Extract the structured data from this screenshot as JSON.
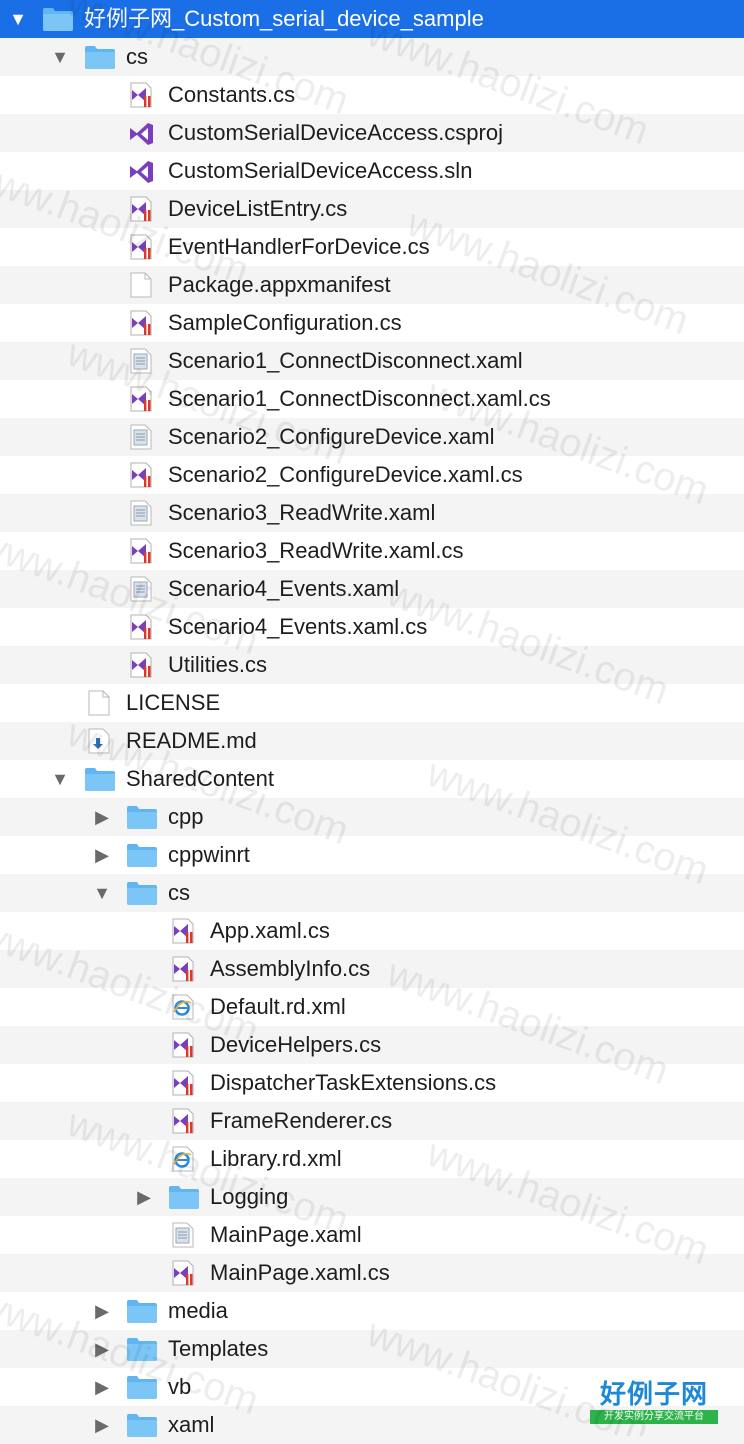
{
  "tree": [
    {
      "label": "好例子网_Custom_serial_device_sample",
      "type": "folder",
      "level": 0,
      "arrow": "expanded",
      "selected": true
    },
    {
      "label": "cs",
      "type": "folder",
      "level": 1,
      "arrow": "expanded"
    },
    {
      "label": "Constants.cs",
      "type": "cs",
      "level": 2
    },
    {
      "label": "CustomSerialDeviceAccess.csproj",
      "type": "vs",
      "level": 2
    },
    {
      "label": "CustomSerialDeviceAccess.sln",
      "type": "vs",
      "level": 2
    },
    {
      "label": "DeviceListEntry.cs",
      "type": "cs",
      "level": 2
    },
    {
      "label": "EventHandlerForDevice.cs",
      "type": "cs",
      "level": 2
    },
    {
      "label": "Package.appxmanifest",
      "type": "blank",
      "level": 2
    },
    {
      "label": "SampleConfiguration.cs",
      "type": "cs",
      "level": 2
    },
    {
      "label": "Scenario1_ConnectDisconnect.xaml",
      "type": "xaml",
      "level": 2
    },
    {
      "label": "Scenario1_ConnectDisconnect.xaml.cs",
      "type": "cs",
      "level": 2
    },
    {
      "label": "Scenario2_ConfigureDevice.xaml",
      "type": "xaml",
      "level": 2
    },
    {
      "label": "Scenario2_ConfigureDevice.xaml.cs",
      "type": "cs",
      "level": 2
    },
    {
      "label": "Scenario3_ReadWrite.xaml",
      "type": "xaml",
      "level": 2
    },
    {
      "label": "Scenario3_ReadWrite.xaml.cs",
      "type": "cs",
      "level": 2
    },
    {
      "label": "Scenario4_Events.xaml",
      "type": "xaml",
      "level": 2
    },
    {
      "label": "Scenario4_Events.xaml.cs",
      "type": "cs",
      "level": 2
    },
    {
      "label": "Utilities.cs",
      "type": "cs",
      "level": 2
    },
    {
      "label": "LICENSE",
      "type": "blank",
      "level": 1
    },
    {
      "label": "README.md",
      "type": "md",
      "level": 1
    },
    {
      "label": "SharedContent",
      "type": "folder",
      "level": 1,
      "arrow": "expanded"
    },
    {
      "label": "cpp",
      "type": "folder",
      "level": 2,
      "arrow": "collapsed"
    },
    {
      "label": "cppwinrt",
      "type": "folder",
      "level": 2,
      "arrow": "collapsed"
    },
    {
      "label": "cs",
      "type": "folder",
      "level": 2,
      "arrow": "expanded"
    },
    {
      "label": "App.xaml.cs",
      "type": "cs",
      "level": 3
    },
    {
      "label": "AssemblyInfo.cs",
      "type": "cs",
      "level": 3
    },
    {
      "label": "Default.rd.xml",
      "type": "xml",
      "level": 3
    },
    {
      "label": "DeviceHelpers.cs",
      "type": "cs",
      "level": 3
    },
    {
      "label": "DispatcherTaskExtensions.cs",
      "type": "cs",
      "level": 3
    },
    {
      "label": "FrameRenderer.cs",
      "type": "cs",
      "level": 3
    },
    {
      "label": "Library.rd.xml",
      "type": "xml",
      "level": 3
    },
    {
      "label": "Logging",
      "type": "folder",
      "level": 3,
      "arrow": "collapsed"
    },
    {
      "label": "MainPage.xaml",
      "type": "xaml",
      "level": 3
    },
    {
      "label": "MainPage.xaml.cs",
      "type": "cs",
      "level": 3
    },
    {
      "label": "media",
      "type": "folder",
      "level": 2,
      "arrow": "collapsed"
    },
    {
      "label": "Templates",
      "type": "folder",
      "level": 2,
      "arrow": "collapsed"
    },
    {
      "label": "vb",
      "type": "folder",
      "level": 2,
      "arrow": "collapsed"
    },
    {
      "label": "xaml",
      "type": "folder",
      "level": 2,
      "arrow": "collapsed"
    }
  ],
  "watermark": "www.haolizi.com",
  "logo": {
    "title": "好例子网",
    "subtitle": "开发实例分享交流平台"
  },
  "colors": {
    "selection": "#1a6fe6",
    "folder": "#5fb6f2",
    "vs_purple": "#7b3fbe",
    "cs_red": "#d9382b"
  }
}
